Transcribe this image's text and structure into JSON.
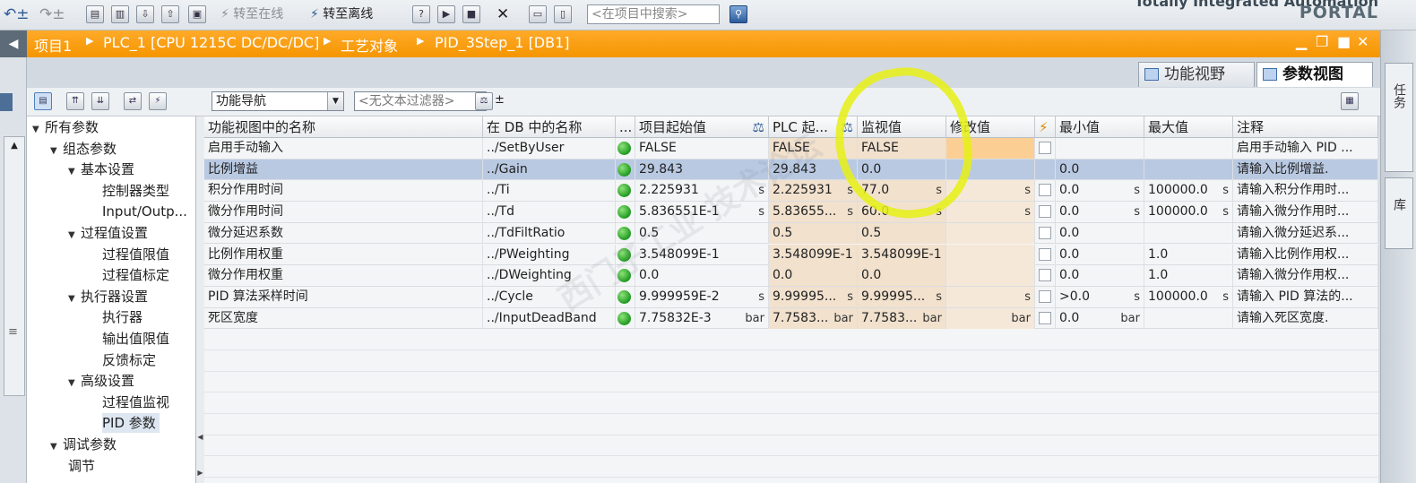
{
  "toolbar": {
    "go_online": "转至在线",
    "go_offline": "转至离线",
    "search_placeholder": "<在项目中搜索>"
  },
  "brand": {
    "line1": "Totally Integrated Automation",
    "line2": "PORTAL"
  },
  "breadcrumb": [
    "项目1",
    "PLC_1 [CPU 1215C DC/DC/DC]",
    "工艺对象",
    "PID_3Step_1 [DB1]"
  ],
  "side_tabs": {
    "tasks": "任务",
    "library": "库"
  },
  "view_tabs": {
    "functional": "功能视野",
    "parameter": "参数视图"
  },
  "toolbar2": {
    "nav_combo": "功能导航",
    "filter_placeholder": "<无文本过滤器>"
  },
  "nav": [
    {
      "label": "所有参数",
      "level": 0,
      "expanded": true
    },
    {
      "label": "组态参数",
      "level": 1,
      "expanded": true
    },
    {
      "label": "基本设置",
      "level": 2,
      "expanded": true
    },
    {
      "label": "控制器类型",
      "level": 3
    },
    {
      "label": "Input/Outp...",
      "level": 3
    },
    {
      "label": "过程值设置",
      "level": 2,
      "expanded": true
    },
    {
      "label": "过程值限值",
      "level": 3
    },
    {
      "label": "过程值标定",
      "level": 3
    },
    {
      "label": "执行器设置",
      "level": 2,
      "expanded": true
    },
    {
      "label": "执行器",
      "level": 3
    },
    {
      "label": "输出值限值",
      "level": 3
    },
    {
      "label": "反馈标定",
      "level": 3
    },
    {
      "label": "高级设置",
      "level": 2,
      "expanded": true
    },
    {
      "label": "过程值监视",
      "level": 3
    },
    {
      "label": "PID 参数",
      "level": 3,
      "selected": true
    },
    {
      "label": "调试参数",
      "level": 1,
      "expanded": true
    },
    {
      "label": "调节",
      "level": 2
    }
  ],
  "table": {
    "headers": {
      "name": "功能视图中的名称",
      "db_name": "在 DB 中的名称",
      "more": "...",
      "start": "项目起始值",
      "plc_start": "PLC 起...",
      "monitor": "监视值",
      "modify": "修改值",
      "min": "最小值",
      "max": "最大值",
      "comment": "注释"
    },
    "rows": [
      {
        "name": "启用手动输入",
        "db": "../SetByUser",
        "start": "FALSE",
        "start_unit": "",
        "plc": "FALSE",
        "plc_unit": "",
        "mon": "FALSE",
        "mon_unit": "",
        "mod_unit": "",
        "min": "",
        "min_unit": "",
        "max": "",
        "max_unit": "",
        "comment": "启用手动输入 PID ..."
      },
      {
        "name": "比例增益",
        "db": "../Gain",
        "start": "29.843",
        "start_unit": "",
        "plc": "29.843",
        "plc_unit": "",
        "mon": "0.0",
        "mon_unit": "",
        "mod_unit": "",
        "min": "0.0",
        "min_unit": "",
        "max": "",
        "max_unit": "",
        "comment": "请输入比例增益."
      },
      {
        "name": "积分作用时间",
        "db": "../Ti",
        "start": "2.225931",
        "start_unit": "s",
        "plc": "2.225931",
        "plc_unit": "s",
        "mon": "77.0",
        "mon_unit": "s",
        "mod_unit": "s",
        "min": "0.0",
        "min_unit": "s",
        "max": "100000.0",
        "max_unit": "s",
        "comment": "请输入积分作用时..."
      },
      {
        "name": "微分作用时间",
        "db": "../Td",
        "start": "5.836551E-1",
        "start_unit": "s",
        "plc": "5.83655...",
        "plc_unit": "s",
        "mon": "60.0",
        "mon_unit": "s",
        "mod_unit": "s",
        "min": "0.0",
        "min_unit": "s",
        "max": "100000.0",
        "max_unit": "s",
        "comment": "请输入微分作用时..."
      },
      {
        "name": "微分延迟系数",
        "db": "../TdFiltRatio",
        "start": "0.5",
        "start_unit": "",
        "plc": "0.5",
        "plc_unit": "",
        "mon": "0.5",
        "mon_unit": "",
        "mod_unit": "",
        "min": "0.0",
        "min_unit": "",
        "max": "",
        "max_unit": "",
        "comment": "请输入微分延迟系..."
      },
      {
        "name": "比例作用权重",
        "db": "../PWeighting",
        "start": "3.548099E-1",
        "start_unit": "",
        "plc": "3.548099E-1",
        "plc_unit": "",
        "mon": "3.548099E-1",
        "mon_unit": "",
        "mod_unit": "",
        "min": "0.0",
        "min_unit": "",
        "max": "1.0",
        "max_unit": "",
        "comment": "请输入比例作用权..."
      },
      {
        "name": "微分作用权重",
        "db": "../DWeighting",
        "start": "0.0",
        "start_unit": "",
        "plc": "0.0",
        "plc_unit": "",
        "mon": "0.0",
        "mon_unit": "",
        "mod_unit": "",
        "min": "0.0",
        "min_unit": "",
        "max": "1.0",
        "max_unit": "",
        "comment": "请输入微分作用权..."
      },
      {
        "name": "PID 算法采样时间",
        "db": "../Cycle",
        "start": "9.999959E-2",
        "start_unit": "s",
        "plc": "9.99995...",
        "plc_unit": "s",
        "mon": "9.99995...",
        "mon_unit": "s",
        "mod_unit": "s",
        "min": ">0.0",
        "min_unit": "s",
        "max": "100000.0",
        "max_unit": "s",
        "comment": "请输入 PID 算法的..."
      },
      {
        "name": "死区宽度",
        "db": "../InputDeadBand",
        "start": "7.75832E-3",
        "start_unit": "bar",
        "plc": "7.7583...",
        "plc_unit": "bar",
        "mon": "7.7583...",
        "mon_unit": "bar",
        "mod_unit": "bar",
        "min": "0.0",
        "min_unit": "bar",
        "max": "",
        "max_unit": "",
        "comment": "请输入死区宽度."
      }
    ]
  },
  "watermark": "西门子工业 技术论坛",
  "colors": {
    "title_bar": "#f59500",
    "highlight": "#e6f014",
    "status_ok": "#1f9a20",
    "selected_row": "#b9c9e2"
  }
}
